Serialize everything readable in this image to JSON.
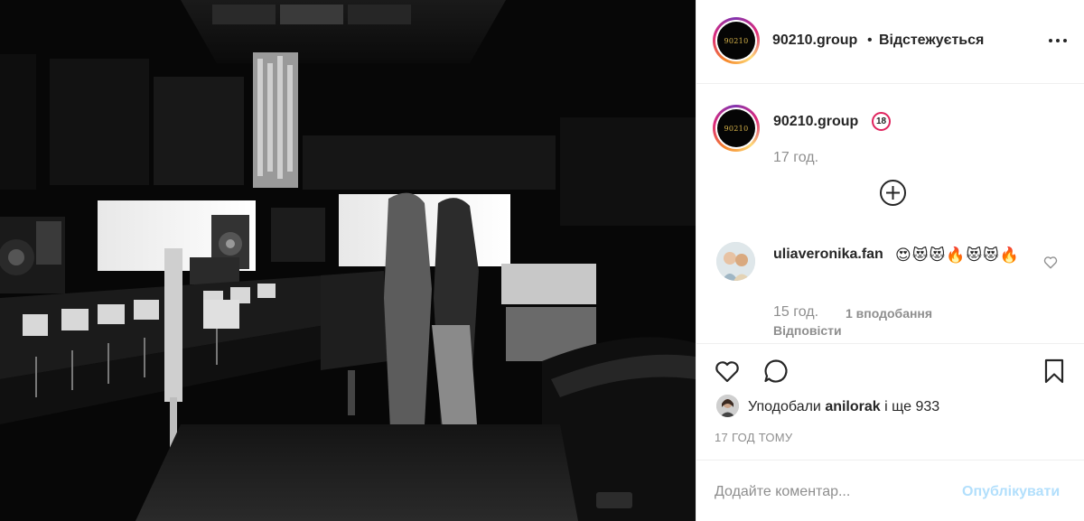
{
  "post": {
    "image_alt": "",
    "icons": {
      "more": "more-dots-icon",
      "add": "plus-circle-icon",
      "comment_like": "heart-outline-icon",
      "like": "heart-outline-icon",
      "comment": "speech-bubble-icon",
      "save": "bookmark-icon"
    }
  },
  "header": {
    "username": "90210.group",
    "separator": "•",
    "follow_label": "Відстежується",
    "avatar_text": "90210"
  },
  "caption": {
    "username": "90210.group",
    "badge": "18",
    "time": "17 год.",
    "avatar_text": "90210"
  },
  "comment": {
    "username": "uliaveronika.fan",
    "text": "😍😻😻🔥😻😻🔥",
    "time": "15 год.",
    "likes": "1 вподобання",
    "reply": "Відповісти"
  },
  "likes": {
    "prefix": "Уподобали",
    "user": "anilorak",
    "suffix": "і ще 933"
  },
  "timestamp": "17 ГОД ТОМУ",
  "add_comment": {
    "placeholder": "Додайте коментар...",
    "post_label": "Опублікувати"
  },
  "colors": {
    "accent_blue_disabled": "#b2dffc",
    "muted_text": "#8e8e8e",
    "text": "#262626",
    "logo_gold": "#d6b24a",
    "badge_red": "#e0245e"
  }
}
